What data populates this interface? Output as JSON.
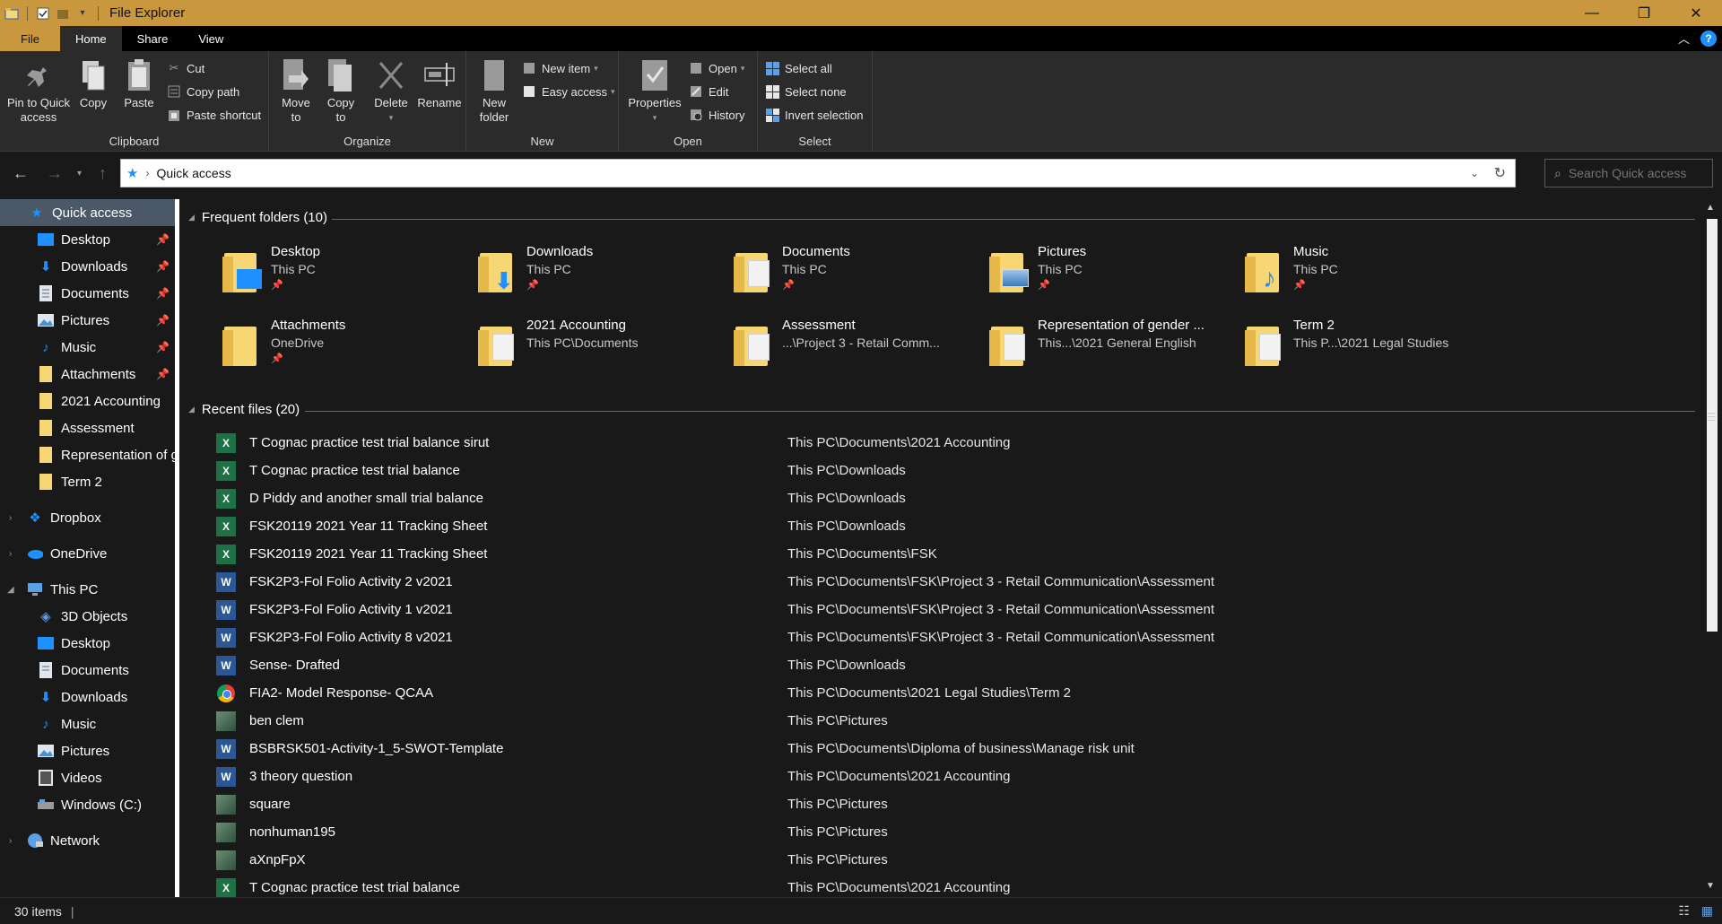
{
  "window": {
    "title": "File Explorer",
    "controls": {
      "minimize": "—",
      "maximize": "❐",
      "close": "✕"
    }
  },
  "ribbon_tabs": [
    "File",
    "Home",
    "Share",
    "View"
  ],
  "ribbon": {
    "clipboard": {
      "label": "Clipboard",
      "pin": "Pin to Quick access",
      "copy": "Copy",
      "paste": "Paste",
      "cut": "Cut",
      "copy_path": "Copy path",
      "paste_shortcut": "Paste shortcut"
    },
    "organize": {
      "label": "Organize",
      "move_to": "Move to",
      "copy_to": "Copy to",
      "delete": "Delete",
      "rename": "Rename"
    },
    "new": {
      "label": "New",
      "new_folder": "New folder",
      "new_item": "New item",
      "easy_access": "Easy access"
    },
    "open": {
      "label": "Open",
      "properties": "Properties",
      "open": "Open",
      "edit": "Edit",
      "history": "History"
    },
    "select": {
      "label": "Select",
      "select_all": "Select all",
      "select_none": "Select none",
      "invert": "Invert selection"
    }
  },
  "address": {
    "path": "Quick access",
    "search_placeholder": "Search Quick access"
  },
  "nav": {
    "quick_access": "Quick access",
    "quick_items": [
      "Desktop",
      "Downloads",
      "Documents",
      "Pictures",
      "Music",
      "Attachments",
      "2021 Accounting",
      "Assessment",
      "Representation of g",
      "Term 2"
    ],
    "dropbox": "Dropbox",
    "onedrive": "OneDrive",
    "this_pc": "This PC",
    "pc_items": [
      "3D Objects",
      "Desktop",
      "Documents",
      "Downloads",
      "Music",
      "Pictures",
      "Videos",
      "Windows (C:)"
    ],
    "network": "Network"
  },
  "frequent": {
    "heading": "Frequent folders (10)",
    "folders": [
      {
        "name": "Desktop",
        "loc": "This PC"
      },
      {
        "name": "Downloads",
        "loc": "This PC"
      },
      {
        "name": "Documents",
        "loc": "This PC"
      },
      {
        "name": "Pictures",
        "loc": "This PC"
      },
      {
        "name": "Music",
        "loc": "This PC"
      },
      {
        "name": "Attachments",
        "loc": "OneDrive"
      },
      {
        "name": "2021 Accounting",
        "loc": "This PC\\Documents"
      },
      {
        "name": "Assessment",
        "loc": "...\\Project 3 - Retail Comm..."
      },
      {
        "name": "Representation of gender ...",
        "loc": "This...\\2021 General English"
      },
      {
        "name": "Term 2",
        "loc": "This P...\\2021 Legal Studies"
      }
    ]
  },
  "recent": {
    "heading": "Recent files (20)",
    "files": [
      {
        "name": "T Cognac practice test trial balance sirut",
        "path": "This PC\\Documents\\2021 Accounting",
        "type": "excel"
      },
      {
        "name": "T Cognac practice test trial balance",
        "path": "This PC\\Downloads",
        "type": "excel"
      },
      {
        "name": "D Piddy and another small trial balance",
        "path": "This PC\\Downloads",
        "type": "excel"
      },
      {
        "name": "FSK20119 2021 Year 11 Tracking Sheet",
        "path": "This PC\\Downloads",
        "type": "excel"
      },
      {
        "name": "FSK20119 2021 Year 11 Tracking Sheet",
        "path": "This PC\\Documents\\FSK",
        "type": "excel"
      },
      {
        "name": "FSK2P3-Fol Folio Activity 2 v2021",
        "path": "This PC\\Documents\\FSK\\Project 3 - Retail Communication\\Assessment",
        "type": "word"
      },
      {
        "name": "FSK2P3-Fol Folio Activity 1 v2021",
        "path": "This PC\\Documents\\FSK\\Project 3 - Retail Communication\\Assessment",
        "type": "word"
      },
      {
        "name": "FSK2P3-Fol Folio Activity 8 v2021",
        "path": "This PC\\Documents\\FSK\\Project 3 - Retail Communication\\Assessment",
        "type": "word"
      },
      {
        "name": "Sense- Drafted",
        "path": "This PC\\Downloads",
        "type": "word"
      },
      {
        "name": "FIA2- Model Response- QCAA",
        "path": "This PC\\Documents\\2021 Legal Studies\\Term 2",
        "type": "chrome"
      },
      {
        "name": "ben clem",
        "path": "This PC\\Pictures",
        "type": "image"
      },
      {
        "name": "BSBRSK501-Activity-1_5-SWOT-Template",
        "path": "This PC\\Documents\\Diploma of business\\Manage risk unit",
        "type": "word"
      },
      {
        "name": "3 theory question",
        "path": "This PC\\Documents\\2021 Accounting",
        "type": "word"
      },
      {
        "name": "square",
        "path": "This PC\\Pictures",
        "type": "image"
      },
      {
        "name": "nonhuman195",
        "path": "This PC\\Pictures",
        "type": "image"
      },
      {
        "name": "aXnpFpX",
        "path": "This PC\\Pictures",
        "type": "image"
      },
      {
        "name": "T Cognac practice test trial balance",
        "path": "This PC\\Documents\\2021 Accounting",
        "type": "excel"
      }
    ]
  },
  "status": {
    "count": "30 items"
  },
  "colors": {
    "titlebar": "#c9973d",
    "background": "#191919",
    "selected": "#4a5868",
    "accent": "#1e90ff"
  }
}
